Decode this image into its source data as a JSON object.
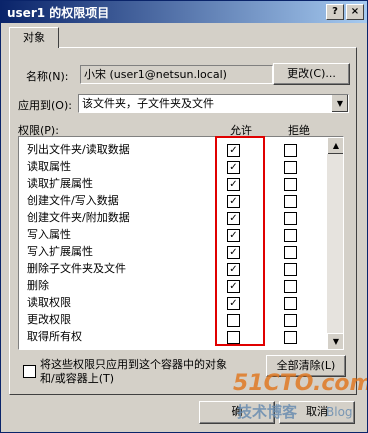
{
  "window": {
    "title": "user1 的权限项目",
    "help_btn": "?",
    "close_btn": "×"
  },
  "tab": {
    "label": "对象"
  },
  "name_row": {
    "label": "名称(N):",
    "value": "小宋 (user1@netsun.local)",
    "change_btn": "更改(C)..."
  },
  "apply_row": {
    "label": "应用到(O):",
    "value": "该文件夹，子文件夹及文件"
  },
  "permissions": {
    "label": "权限(P):",
    "allow_header": "允许",
    "deny_header": "拒绝",
    "rows": [
      {
        "name": "列出文件夹/读取数据",
        "allow": true,
        "deny": false
      },
      {
        "name": "读取属性",
        "allow": true,
        "deny": false
      },
      {
        "name": "读取扩展属性",
        "allow": true,
        "deny": false
      },
      {
        "name": "创建文件/写入数据",
        "allow": true,
        "deny": false
      },
      {
        "name": "创建文件夹/附加数据",
        "allow": true,
        "deny": false
      },
      {
        "name": "写入属性",
        "allow": true,
        "deny": false
      },
      {
        "name": "写入扩展属性",
        "allow": true,
        "deny": false
      },
      {
        "name": "删除子文件夹及文件",
        "allow": true,
        "deny": false
      },
      {
        "name": "删除",
        "allow": true,
        "deny": false
      },
      {
        "name": "读取权限",
        "allow": true,
        "deny": false
      },
      {
        "name": "更改权限",
        "allow": false,
        "deny": false
      },
      {
        "name": "取得所有权",
        "allow": false,
        "deny": false
      }
    ],
    "highlight_color": "#e00000"
  },
  "apply_checkbox": {
    "checked": false,
    "label_line1": "将这些权限只应用到这个容器中的对象",
    "label_line2": "和/或容器上(T)"
  },
  "clear_all_btn": "全部清除(L)",
  "footer": {
    "ok_btn": "确",
    "cancel_btn": "取消"
  },
  "watermark": {
    "line1": "51CTO.com",
    "line2": "技术博客",
    "line3": "Blog"
  }
}
